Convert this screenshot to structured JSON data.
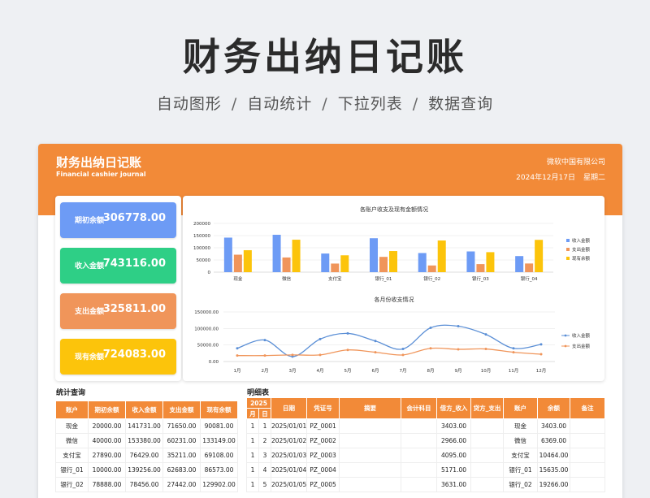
{
  "hero": {
    "title": "财务出纳日记账",
    "features": [
      "自动图形",
      "自动统计",
      "下拉列表",
      "数据查询"
    ],
    "separator": "/"
  },
  "header": {
    "title": "财务出纳日记账",
    "subtitle": "Financial cashier journal",
    "company": "微软中国有限公司",
    "date": "2024年12月17日",
    "weekday": "星期二"
  },
  "summary_cards": [
    {
      "label": "期初余额",
      "value": "306778.00",
      "color": "#6d9bf5"
    },
    {
      "label": "收入金额",
      "value": "743116.00",
      "color": "#2ecf86"
    },
    {
      "label": "支出金额",
      "value": "325811.00",
      "color": "#f0955a"
    },
    {
      "label": "现有余额",
      "value": "724083.00",
      "color": "#fcc40b"
    }
  ],
  "chart_data": [
    {
      "type": "bar",
      "title": "各账户收支及现有金额情况",
      "categories": [
        "现金",
        "微信",
        "支付宝",
        "银行_01",
        "银行_02",
        "银行_03",
        "银行_04"
      ],
      "series": [
        {
          "name": "收入金额",
          "color": "#6d9bf5",
          "values": [
            141731,
            153380,
            76429,
            139256,
            78456,
            85000,
            66000
          ]
        },
        {
          "name": "支出金额",
          "color": "#f0955a",
          "values": [
            71650,
            60231,
            35211,
            62683,
            27442,
            33000,
            35500
          ]
        },
        {
          "name": "现有余额",
          "color": "#fcc40b",
          "values": [
            90081,
            133149,
            69108,
            86573,
            129902,
            82000,
            132500
          ]
        }
      ],
      "yticks": [
        "200000",
        "150000",
        "100000",
        "50000",
        "0"
      ],
      "ylim": [
        0,
        200000
      ],
      "legend": "right",
      "grid": true
    },
    {
      "type": "line",
      "title": "各月份收支情况",
      "categories": [
        "1月",
        "2月",
        "3月",
        "4月",
        "5月",
        "6月",
        "7月",
        "8月",
        "9月",
        "10月",
        "11月",
        "12月"
      ],
      "series": [
        {
          "name": "收入金额",
          "color": "#5b8fd6",
          "values": [
            40000,
            65000,
            15000,
            68000,
            85000,
            62000,
            38000,
            102000,
            107000,
            82000,
            40000,
            52000
          ]
        },
        {
          "name": "支出金额",
          "color": "#f0955a",
          "values": [
            18000,
            18000,
            20000,
            20000,
            35000,
            28000,
            20000,
            40000,
            37000,
            38000,
            28000,
            22000
          ]
        }
      ],
      "yticks": [
        "150000.00",
        "100000.00",
        "50000.00",
        "0.00"
      ],
      "ylim": [
        0,
        150000
      ],
      "legend": "right",
      "grid": true
    }
  ],
  "stats": {
    "title": "统计查询",
    "columns": [
      "账户",
      "期初余额",
      "收入金额",
      "支出金额",
      "现有余额"
    ],
    "rows": [
      [
        "现金",
        "20000.00",
        "141731.00",
        "71650.00",
        "90081.00"
      ],
      [
        "微信",
        "40000.00",
        "153380.00",
        "60231.00",
        "133149.00"
      ],
      [
        "支付宝",
        "27890.00",
        "76429.00",
        "35211.00",
        "69108.00"
      ],
      [
        "银行_01",
        "10000.00",
        "139256.00",
        "62683.00",
        "86573.00"
      ],
      [
        "银行_02",
        "78888.00",
        "78456.00",
        "27442.00",
        "129902.00"
      ]
    ]
  },
  "detail": {
    "title": "明细表",
    "year": "2025",
    "month_label": "月",
    "day_label": "日",
    "columns": [
      "日期",
      "凭证号",
      "摘要",
      "会计科目",
      "借方_收入",
      "贷方_支出",
      "账户",
      "余额",
      "备注"
    ],
    "rows": [
      [
        "1",
        "1",
        "2025/01/01",
        "PZ_0001",
        "",
        "",
        "3403.00",
        "",
        "现金",
        "3403.00",
        ""
      ],
      [
        "1",
        "2",
        "2025/01/02",
        "PZ_0002",
        "",
        "",
        "2966.00",
        "",
        "微信",
        "6369.00",
        ""
      ],
      [
        "1",
        "3",
        "2025/01/03",
        "PZ_0003",
        "",
        "",
        "4095.00",
        "",
        "支付宝",
        "10464.00",
        ""
      ],
      [
        "1",
        "4",
        "2025/01/04",
        "PZ_0004",
        "",
        "",
        "5171.00",
        "",
        "银行_01",
        "15635.00",
        ""
      ],
      [
        "1",
        "5",
        "2025/01/05",
        "PZ_0005",
        "",
        "",
        "3631.00",
        "",
        "银行_02",
        "19266.00",
        ""
      ]
    ]
  }
}
